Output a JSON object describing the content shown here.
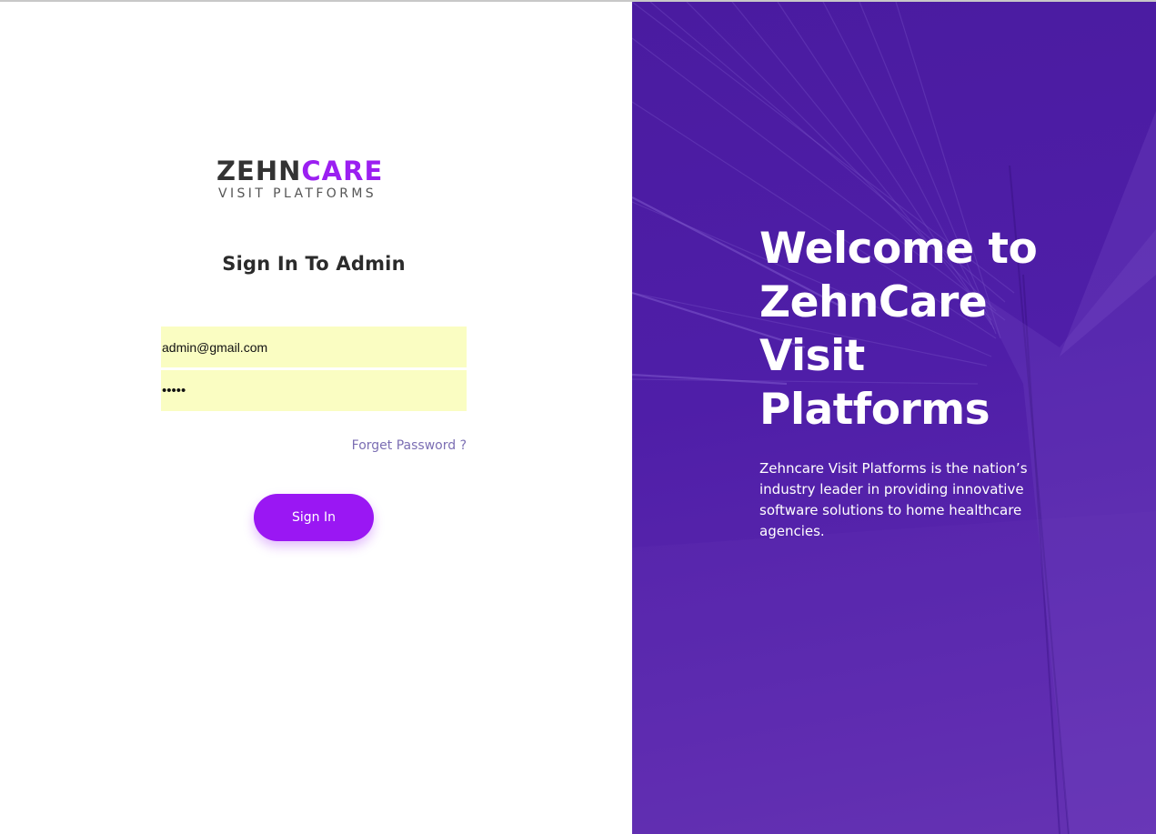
{
  "logo": {
    "word_dark": "ZEHN",
    "word_accent": "CARE",
    "tagline": "VISIT PLATFORMS"
  },
  "login": {
    "title": "Sign In To Admin",
    "email_value": "admin@gmail.com",
    "password_value": "•••••",
    "forgot_label": "Forget Password ?",
    "signin_label": "Sign In"
  },
  "hero": {
    "heading": "Welcome to ZehnCare Visit Platforms",
    "description": "Zehncare Visit Platforms is the nation’s industry leader in providing innovative software solutions to home healthcare agencies."
  },
  "colors": {
    "accent": "#9a17f3",
    "hero_bg": "#4f1ea8",
    "autofill_bg": "#fafdc2",
    "link": "#7b6eb3"
  }
}
